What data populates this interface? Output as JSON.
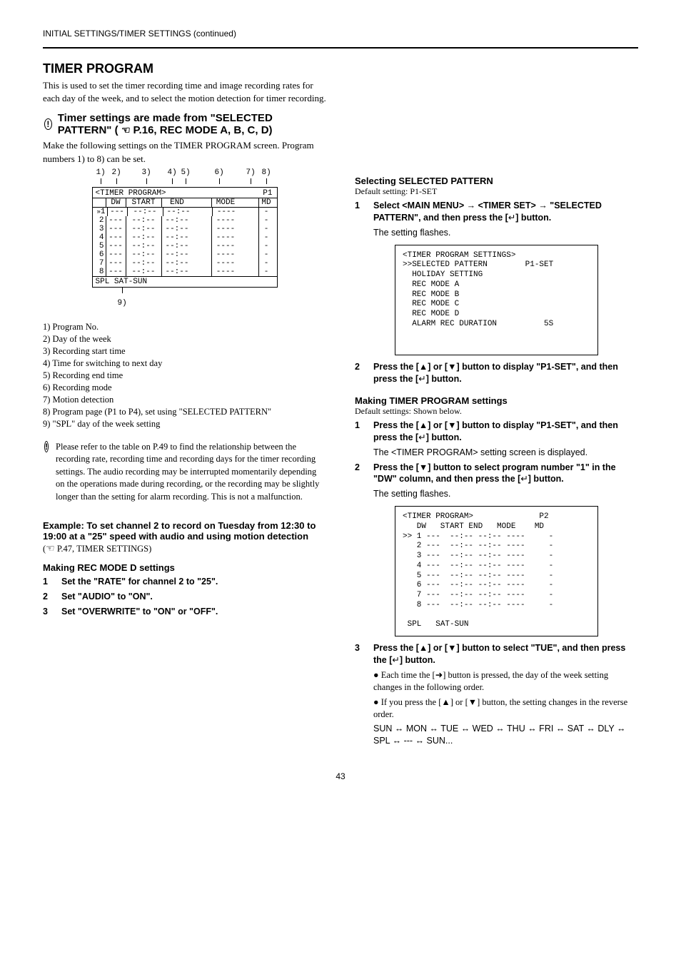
{
  "top": {
    "rubric": "INITIAL SETTINGS/TIMER SETTINGS (continued)",
    "h1": "TIMER PROGRAM",
    "hand_ref": "P.16, REC MODE A, B, C, D)"
  },
  "intro": {
    "p1": "This is used to set the timer recording time and image recording rates for each day of the week, and to select the motion detection for timer recording.",
    "p2": "Timer settings are made from \"SELECTED PATTERN\" (",
    "p3": "Make the following settings on the TIMER PROGRAM screen. Program numbers 1) to 8) can be set."
  },
  "diagram": {
    "labels": [
      "1)",
      "2)",
      "3)",
      "4)",
      "5)",
      "6)",
      "7)",
      "8)"
    ],
    "title": "<TIMER PROGRAM>",
    "page_ind": "P1",
    "head": {
      "dw": "DW",
      "start": "START",
      "end": "END",
      "mode": "MODE",
      "md": "MD"
    },
    "rows": [
      {
        "n": "1",
        "dw": "---",
        "st": "--:--",
        "en": "--:--",
        "mo": "----",
        "md": "-"
      },
      {
        "n": "2",
        "dw": "---",
        "st": "--:--",
        "en": "--:--",
        "mo": "----",
        "md": "-"
      },
      {
        "n": "3",
        "dw": "---",
        "st": "--:--",
        "en": "--:--",
        "mo": "----",
        "md": "-"
      },
      {
        "n": "4",
        "dw": "---",
        "st": "--:--",
        "en": "--:--",
        "mo": "----",
        "md": "-"
      },
      {
        "n": "5",
        "dw": "---",
        "st": "--:--",
        "en": "--:--",
        "mo": "----",
        "md": "-"
      },
      {
        "n": "6",
        "dw": "---",
        "st": "--:--",
        "en": "--:--",
        "mo": "----",
        "md": "-"
      },
      {
        "n": "7",
        "dw": "---",
        "st": "--:--",
        "en": "--:--",
        "mo": "----",
        "md": "-"
      },
      {
        "n": "8",
        "dw": "---",
        "st": "--:--",
        "en": "--:--",
        "mo": "----",
        "md": "-"
      }
    ],
    "spl": "SPL    SAT-SUN",
    "cb": "9)"
  },
  "legend": [
    "1) Program No.",
    "2) Day of the week",
    "3) Recording start time",
    "4) Time for switching to next day",
    "5) Recording end time",
    "6) Recording mode",
    "7) Motion detection",
    "8) Program page (P1 to P4), set using \"SELECTED PATTERN\"",
    "9) \"SPL\" day of the week setting"
  ],
  "ex_caution": {
    "dot": "!",
    "text": "Please refer to the table on P.49 to find the relationship between the recording rate, recording time and recording days for the timer recording settings. The audio recording may be interrupted momentarily depending on the operations made during recording, or the recording may be slightly longer than the setting for alarm recording. This is not a malfunction."
  },
  "ex_block": {
    "h": "Example: To set channel 2 to record on Tuesday from 12:30 to 19:00 at a \"25\" speed with audio and using motion detection",
    "hand_txt": "P.47, TIMER SETTINGS)",
    "x_title": "Making REC MODE D settings",
    "x_steps": [
      "Set the \"RATE\" for channel 2 to \"25\".",
      "Set \"AUDIO\" to \"ON\".",
      "Set \"OVERWRITE\" to \"ON\" or \"OFF\"."
    ]
  },
  "right": {
    "sel_title": "Selecting SELECTED PATTERN",
    "sel_sub": "Default setting: P1-SET",
    "sel_steps": {
      "s1a": "Select <MAIN MENU> ",
      "s1b": " <TIMER SET> ",
      "s1c": " \"SELECTED PATTERN\", and then press the [",
      "s1d": "] button.",
      "s1_note": "The setting flashes.",
      "s2a": "Press the [",
      "s2b": "] or [",
      "s2c": "] button to display \"P1-SET\", and then press the [",
      "s2d": "] button."
    },
    "osd1": {
      "l1": "<TIMER PROGRAM SETTINGS>",
      "l2": "SELECTED PATTERN        P1-SET",
      "l3": "HOLIDAY SETTING",
      "l4": "REC MODE A",
      "l5": "REC MODE B",
      "l6": "REC MODE C",
      "l7": "REC MODE D",
      "l8": "ALARM REC DURATION          5S",
      "caret": ">>"
    },
    "tp_title": "Making TIMER PROGRAM settings",
    "tp_sub": "Default settings: Shown below.",
    "tp_steps": {
      "s1a": "Press the [",
      "s1b": "] or [",
      "s1c": "] button to display \"P1-SET\", and then press the [",
      "s1d": "] button.",
      "s1_note": "The <TIMER PROGRAM> setting screen is displayed.",
      "s2a": "Press the [",
      "s2b": "] button to select program number \"1\" in the \"DW\" column, and then press the [",
      "s2c": "] button.",
      "s2_note": "The setting flashes."
    },
    "osd2": {
      "title": "<TIMER PROGRAM>              P2",
      "head": "   DW   START END   MODE    MD",
      "rows": [
        " 1 ---  --:-- --:-- ----     -",
        " 2 ---  --:-- --:-- ----     -",
        " 3 ---  --:-- --:-- ----     -",
        " 4 ---  --:-- --:-- ----     -",
        " 5 ---  --:-- --:-- ----     -",
        " 6 ---  --:-- --:-- ----     -",
        " 7 ---  --:-- --:-- ----     -",
        " 8 ---  --:-- --:-- ----     -"
      ],
      "spl": "SPL   SAT-SUN",
      "caret": ">>"
    },
    "tp3": {
      "s3a": "Press the [",
      "s3b": "] or [",
      "s3c": "] button to select \"TUE\", and then press the [",
      "s3d": "] button.",
      "bullet1_a": "Each time the [",
      "bullet1_b": "] button is pressed, the day of the week setting changes in the following order.",
      "bullet2_a": "If you press the [",
      "bullet2_b": "] or [",
      "bullet2_c": "] button, the setting changes in the reverse order.",
      "seq": "SUN ↔ MON ↔ TUE ↔ WED ↔ THU ↔ FRI ↔ SAT ↔ DLY ↔ SPL ↔ --- ↔ SUN..."
    }
  },
  "page": "43"
}
